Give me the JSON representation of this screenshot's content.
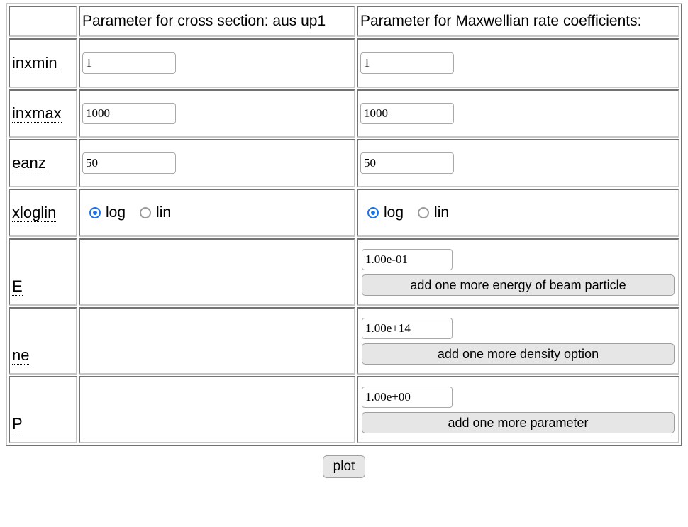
{
  "table": {
    "columns": [
      {
        "key": "label",
        "header": ""
      },
      {
        "key": "cross",
        "header": "Parameter for cross section: aus up1"
      },
      {
        "key": "maxwell",
        "header": "Parameter for Maxwellian rate coefficients:"
      }
    ],
    "rows": [
      {
        "label": "inxmin",
        "cross": {
          "type": "text",
          "value": "1"
        },
        "maxwell": {
          "type": "text",
          "value": "1"
        }
      },
      {
        "label": "inxmax",
        "cross": {
          "type": "text",
          "value": "1000"
        },
        "maxwell": {
          "type": "text",
          "value": "1000"
        }
      },
      {
        "label": "eanz",
        "cross": {
          "type": "text",
          "value": "50"
        },
        "maxwell": {
          "type": "text",
          "value": "50"
        }
      },
      {
        "label": "xloglin",
        "cross": {
          "type": "radio",
          "options": [
            "log",
            "lin"
          ],
          "selected": "log"
        },
        "maxwell": {
          "type": "radio",
          "options": [
            "log",
            "lin"
          ],
          "selected": "log"
        }
      },
      {
        "label": "E",
        "cross": {
          "type": "empty"
        },
        "maxwell": {
          "type": "value-and-button",
          "value": "1.00e-01",
          "button": "add one more energy of beam particle"
        }
      },
      {
        "label": "ne",
        "cross": {
          "type": "empty"
        },
        "maxwell": {
          "type": "value-and-button",
          "value": "1.00e+14",
          "button": "add one more density option"
        }
      },
      {
        "label": "P",
        "cross": {
          "type": "empty"
        },
        "maxwell": {
          "type": "value-and-button",
          "value": "1.00e+00",
          "button": "add one more parameter"
        }
      }
    ]
  },
  "footer": {
    "plot_label": "plot"
  },
  "colors": {
    "radio_selected": "#1a73e8",
    "radio_unselected": "#9a9a9a",
    "button_background": "#e6e6e6",
    "cell_border": "#c6c6c6",
    "input_border": "#a9a9a9",
    "text": "#000000"
  }
}
